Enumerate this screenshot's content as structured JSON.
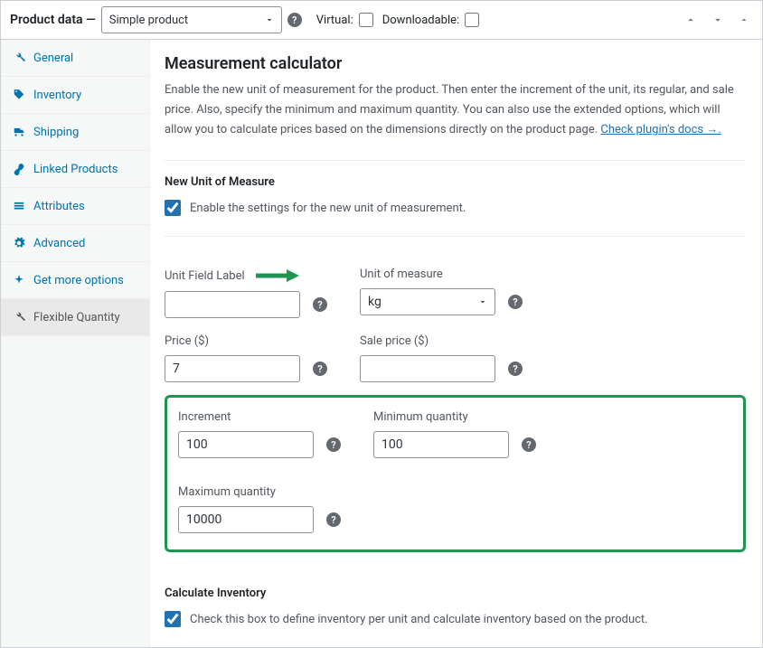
{
  "header": {
    "title": "Product data —",
    "product_type": "Simple product",
    "virtual_label": "Virtual:",
    "virtual_checked": false,
    "downloadable_label": "Downloadable:",
    "downloadable_checked": false
  },
  "tabs": {
    "general": "General",
    "inventory": "Inventory",
    "shipping": "Shipping",
    "linked": "Linked Products",
    "attributes": "Attributes",
    "advanced": "Advanced",
    "get_more": "Get more options",
    "flexible": "Flexible Quantity"
  },
  "section": {
    "title": "Measurement calculator",
    "desc": "Enable the new unit of measurement for the product. Then enter the increment of the unit, its regular, and sale price. Also, specify the minimum and maximum quantity. You can also use the extended options, which will allow you to calculate prices based on the dimensions directly on the product page. ",
    "docs_link": "Check plugin's docs →."
  },
  "new_unit": {
    "heading": "New Unit of Measure",
    "enable_label": "Enable the settings for the new unit of measurement.",
    "enabled": true
  },
  "fields": {
    "unit_field_label": "Unit Field Label",
    "unit_field_value": "",
    "unit_of_measure_label": "Unit of measure",
    "unit_of_measure_value": "kg",
    "price_label": "Price ($)",
    "price_value": "7",
    "sale_price_label": "Sale price ($)",
    "sale_price_value": "",
    "increment_label": "Increment",
    "increment_value": "100",
    "min_qty_label": "Minimum quantity",
    "min_qty_value": "100",
    "max_qty_label": "Maximum quantity",
    "max_qty_value": "10000"
  },
  "calc_inventory": {
    "heading": "Calculate Inventory",
    "label": "Check this box to define inventory per unit and calculate inventory based on the product.",
    "checked": true
  }
}
